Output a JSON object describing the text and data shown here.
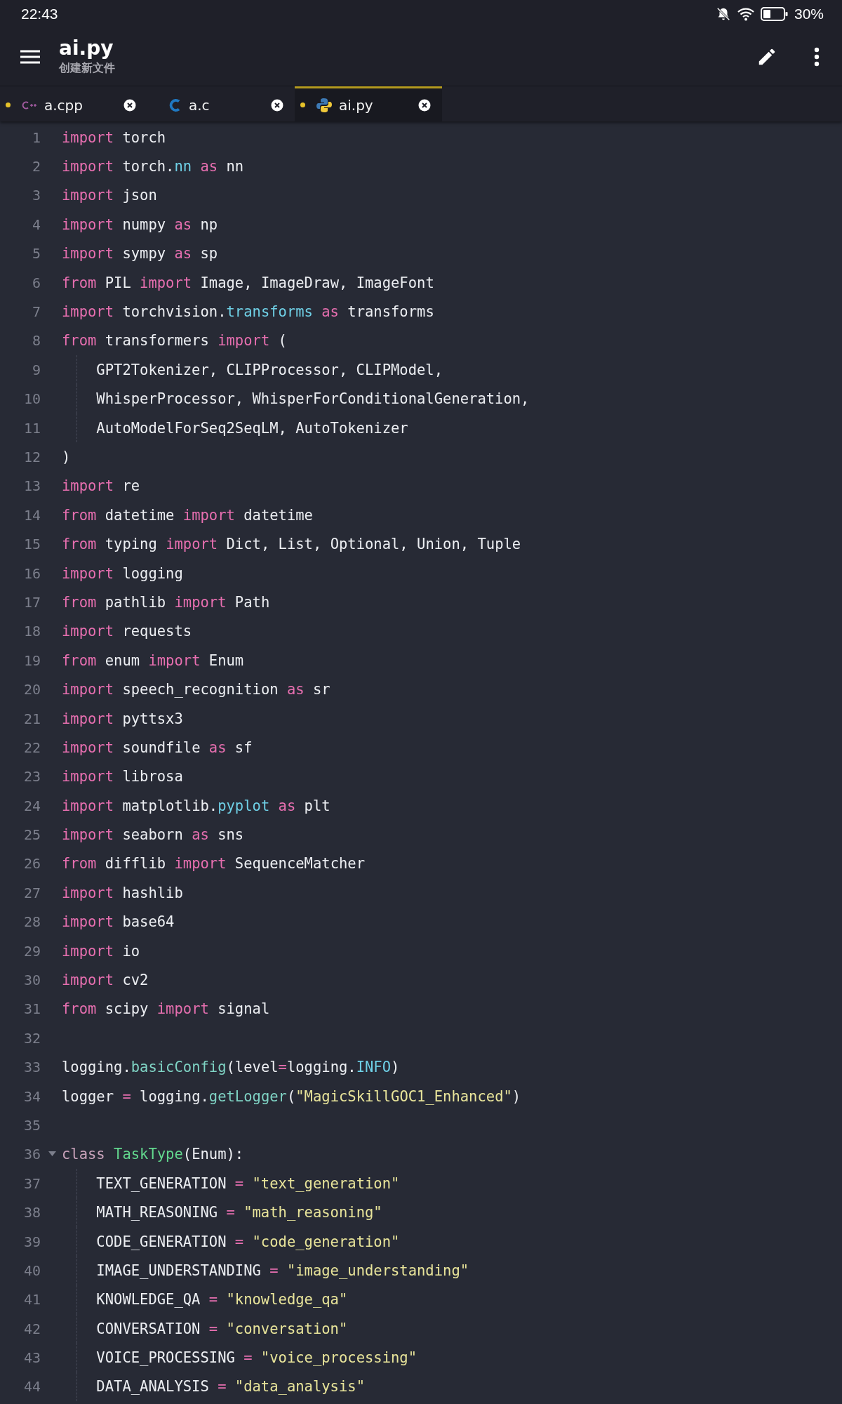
{
  "status_bar": {
    "time": "22:43",
    "battery": "30%"
  },
  "toolbar": {
    "title": "ai.py",
    "subtitle": "创建新文件"
  },
  "tabs": [
    {
      "label": "a.cpp",
      "kind": "cpp",
      "selected": false,
      "modified": true
    },
    {
      "label": "a.c",
      "kind": "c",
      "selected": false,
      "modified": false
    },
    {
      "label": "ai.py",
      "kind": "python",
      "selected": true,
      "modified": true
    }
  ],
  "editor": {
    "lines": [
      {
        "number": "1",
        "tokens": [
          {
            "kind": "kw",
            "text": "import"
          },
          {
            "kind": "plain",
            "text": " torch"
          }
        ]
      },
      {
        "number": "2",
        "tokens": [
          {
            "kind": "kw",
            "text": "import"
          },
          {
            "kind": "plain",
            "text": " torch."
          },
          {
            "kind": "attr",
            "text": "nn"
          },
          {
            "kind": "kw",
            "text": " as"
          },
          {
            "kind": "plain",
            "text": " nn"
          }
        ]
      },
      {
        "number": "3",
        "tokens": [
          {
            "kind": "kw",
            "text": "import"
          },
          {
            "kind": "plain",
            "text": " json"
          }
        ]
      },
      {
        "number": "4",
        "tokens": [
          {
            "kind": "kw",
            "text": "import"
          },
          {
            "kind": "plain",
            "text": " numpy "
          },
          {
            "kind": "kw",
            "text": "as"
          },
          {
            "kind": "plain",
            "text": " np"
          }
        ]
      },
      {
        "number": "5",
        "tokens": [
          {
            "kind": "kw",
            "text": "import"
          },
          {
            "kind": "plain",
            "text": " sympy "
          },
          {
            "kind": "kw",
            "text": "as"
          },
          {
            "kind": "plain",
            "text": " sp"
          }
        ]
      },
      {
        "number": "6",
        "tokens": [
          {
            "kind": "kw",
            "text": "from"
          },
          {
            "kind": "plain",
            "text": " PIL "
          },
          {
            "kind": "kw",
            "text": "import"
          },
          {
            "kind": "plain",
            "text": " Image, ImageDraw, ImageFont"
          }
        ]
      },
      {
        "number": "7",
        "tokens": [
          {
            "kind": "kw",
            "text": "import"
          },
          {
            "kind": "plain",
            "text": " torchvision."
          },
          {
            "kind": "attr",
            "text": "transforms"
          },
          {
            "kind": "kw",
            "text": " as"
          },
          {
            "kind": "plain",
            "text": " transforms"
          }
        ]
      },
      {
        "number": "8",
        "tokens": [
          {
            "kind": "kw",
            "text": "from"
          },
          {
            "kind": "plain",
            "text": " transformers "
          },
          {
            "kind": "kw",
            "text": "import"
          },
          {
            "kind": "plain",
            "text": " ("
          }
        ]
      },
      {
        "number": "9",
        "indent": true,
        "tokens": [
          {
            "kind": "plain",
            "text": "GPT2Tokenizer, CLIPProcessor, CLIPModel,"
          }
        ]
      },
      {
        "number": "10",
        "indent": true,
        "tokens": [
          {
            "kind": "plain",
            "text": "WhisperProcessor, WhisperForConditionalGeneration,"
          }
        ]
      },
      {
        "number": "11",
        "indent": true,
        "tokens": [
          {
            "kind": "plain",
            "text": "AutoModelForSeq2SeqLM, AutoTokenizer"
          }
        ]
      },
      {
        "number": "12",
        "tokens": [
          {
            "kind": "plain",
            "text": ")"
          }
        ]
      },
      {
        "number": "13",
        "tokens": [
          {
            "kind": "kw",
            "text": "import"
          },
          {
            "kind": "plain",
            "text": " re"
          }
        ]
      },
      {
        "number": "14",
        "tokens": [
          {
            "kind": "kw",
            "text": "from"
          },
          {
            "kind": "plain",
            "text": " datetime "
          },
          {
            "kind": "kw",
            "text": "import"
          },
          {
            "kind": "plain",
            "text": " datetime"
          }
        ]
      },
      {
        "number": "15",
        "tokens": [
          {
            "kind": "kw",
            "text": "from"
          },
          {
            "kind": "plain",
            "text": " typing "
          },
          {
            "kind": "kw",
            "text": "import"
          },
          {
            "kind": "plain",
            "text": " Dict, List, Optional, Union, Tuple"
          }
        ]
      },
      {
        "number": "16",
        "tokens": [
          {
            "kind": "kw",
            "text": "import"
          },
          {
            "kind": "plain",
            "text": " logging"
          }
        ]
      },
      {
        "number": "17",
        "tokens": [
          {
            "kind": "kw",
            "text": "from"
          },
          {
            "kind": "plain",
            "text": " pathlib "
          },
          {
            "kind": "kw",
            "text": "import"
          },
          {
            "kind": "plain",
            "text": " Path"
          }
        ]
      },
      {
        "number": "18",
        "tokens": [
          {
            "kind": "kw",
            "text": "import"
          },
          {
            "kind": "plain",
            "text": " requests"
          }
        ]
      },
      {
        "number": "19",
        "tokens": [
          {
            "kind": "kw",
            "text": "from"
          },
          {
            "kind": "plain",
            "text": " enum "
          },
          {
            "kind": "kw",
            "text": "import"
          },
          {
            "kind": "plain",
            "text": " Enum"
          }
        ]
      },
      {
        "number": "20",
        "tokens": [
          {
            "kind": "kw",
            "text": "import"
          },
          {
            "kind": "plain",
            "text": " speech_recognition "
          },
          {
            "kind": "kw",
            "text": "as"
          },
          {
            "kind": "plain",
            "text": " sr"
          }
        ]
      },
      {
        "number": "21",
        "tokens": [
          {
            "kind": "kw",
            "text": "import"
          },
          {
            "kind": "plain",
            "text": " pyttsx3"
          }
        ]
      },
      {
        "number": "22",
        "tokens": [
          {
            "kind": "kw",
            "text": "import"
          },
          {
            "kind": "plain",
            "text": " soundfile "
          },
          {
            "kind": "kw",
            "text": "as"
          },
          {
            "kind": "plain",
            "text": " sf"
          }
        ]
      },
      {
        "number": "23",
        "tokens": [
          {
            "kind": "kw",
            "text": "import"
          },
          {
            "kind": "plain",
            "text": " librosa"
          }
        ]
      },
      {
        "number": "24",
        "tokens": [
          {
            "kind": "kw",
            "text": "import"
          },
          {
            "kind": "plain",
            "text": " matplotlib."
          },
          {
            "kind": "attr",
            "text": "pyplot"
          },
          {
            "kind": "kw",
            "text": " as"
          },
          {
            "kind": "plain",
            "text": " plt"
          }
        ]
      },
      {
        "number": "25",
        "tokens": [
          {
            "kind": "kw",
            "text": "import"
          },
          {
            "kind": "plain",
            "text": " seaborn "
          },
          {
            "kind": "kw",
            "text": "as"
          },
          {
            "kind": "plain",
            "text": " sns"
          }
        ]
      },
      {
        "number": "26",
        "tokens": [
          {
            "kind": "kw",
            "text": "from"
          },
          {
            "kind": "plain",
            "text": " difflib "
          },
          {
            "kind": "kw",
            "text": "import"
          },
          {
            "kind": "plain",
            "text": " SequenceMatcher"
          }
        ]
      },
      {
        "number": "27",
        "tokens": [
          {
            "kind": "kw",
            "text": "import"
          },
          {
            "kind": "plain",
            "text": " hashlib"
          }
        ]
      },
      {
        "number": "28",
        "tokens": [
          {
            "kind": "kw",
            "text": "import"
          },
          {
            "kind": "plain",
            "text": " base64"
          }
        ]
      },
      {
        "number": "29",
        "tokens": [
          {
            "kind": "kw",
            "text": "import"
          },
          {
            "kind": "plain",
            "text": " io"
          }
        ]
      },
      {
        "number": "30",
        "tokens": [
          {
            "kind": "kw",
            "text": "import"
          },
          {
            "kind": "plain",
            "text": " cv2"
          }
        ]
      },
      {
        "number": "31",
        "tokens": [
          {
            "kind": "kw",
            "text": "from"
          },
          {
            "kind": "plain",
            "text": " scipy "
          },
          {
            "kind": "kw",
            "text": "import"
          },
          {
            "kind": "plain",
            "text": " signal"
          }
        ]
      },
      {
        "number": "32"
      },
      {
        "number": "33",
        "tokens": [
          {
            "kind": "plain",
            "text": "logging."
          },
          {
            "kind": "func",
            "text": "basicConfig"
          },
          {
            "kind": "plain",
            "text": "(level"
          },
          {
            "kind": "op",
            "text": "="
          },
          {
            "kind": "plain",
            "text": "logging."
          },
          {
            "kind": "attr",
            "text": "INFO"
          },
          {
            "kind": "plain",
            "text": ")"
          }
        ]
      },
      {
        "number": "34",
        "tokens": [
          {
            "kind": "plain",
            "text": "logger "
          },
          {
            "kind": "op",
            "text": "="
          },
          {
            "kind": "plain",
            "text": " logging."
          },
          {
            "kind": "func",
            "text": "getLogger"
          },
          {
            "kind": "plain",
            "text": "("
          },
          {
            "kind": "str",
            "text": "\"MagicSkillGOC1_Enhanced\""
          },
          {
            "kind": "plain",
            "text": ")"
          }
        ]
      },
      {
        "number": "35"
      },
      {
        "number": "36",
        "foldable": true,
        "tokens": [
          {
            "kind": "storage",
            "text": "class"
          },
          {
            "kind": "cls",
            "text": " TaskType"
          },
          {
            "kind": "plain",
            "text": "(Enum):"
          }
        ]
      },
      {
        "number": "37",
        "indent": true,
        "tokens": [
          {
            "kind": "plain",
            "text": "TEXT_GENERATION "
          },
          {
            "kind": "op",
            "text": "="
          },
          {
            "kind": "str",
            "text": " \"text_generation\""
          }
        ]
      },
      {
        "number": "38",
        "indent": true,
        "tokens": [
          {
            "kind": "plain",
            "text": "MATH_REASONING "
          },
          {
            "kind": "op",
            "text": "="
          },
          {
            "kind": "str",
            "text": " \"math_reasoning\""
          }
        ]
      },
      {
        "number": "39",
        "indent": true,
        "tokens": [
          {
            "kind": "plain",
            "text": "CODE_GENERATION "
          },
          {
            "kind": "op",
            "text": "="
          },
          {
            "kind": "str",
            "text": " \"code_generation\""
          }
        ]
      },
      {
        "number": "40",
        "indent": true,
        "tokens": [
          {
            "kind": "plain",
            "text": "IMAGE_UNDERSTANDING "
          },
          {
            "kind": "op",
            "text": "="
          },
          {
            "kind": "str",
            "text": " \"image_understanding\""
          }
        ]
      },
      {
        "number": "41",
        "indent": true,
        "tokens": [
          {
            "kind": "plain",
            "text": "KNOWLEDGE_QA "
          },
          {
            "kind": "op",
            "text": "="
          },
          {
            "kind": "str",
            "text": " \"knowledge_qa\""
          }
        ]
      },
      {
        "number": "42",
        "indent": true,
        "tokens": [
          {
            "kind": "plain",
            "text": "CONVERSATION "
          },
          {
            "kind": "op",
            "text": "="
          },
          {
            "kind": "str",
            "text": " \"conversation\""
          }
        ]
      },
      {
        "number": "43",
        "indent": true,
        "tokens": [
          {
            "kind": "plain",
            "text": "VOICE_PROCESSING "
          },
          {
            "kind": "op",
            "text": "="
          },
          {
            "kind": "str",
            "text": " \"voice_processing\""
          }
        ]
      },
      {
        "number": "44",
        "indent": true,
        "tokens": [
          {
            "kind": "plain",
            "text": "DATA_ANALYSIS "
          },
          {
            "kind": "op",
            "text": "="
          },
          {
            "kind": "str",
            "text": " \"data_analysis\""
          }
        ]
      }
    ]
  }
}
